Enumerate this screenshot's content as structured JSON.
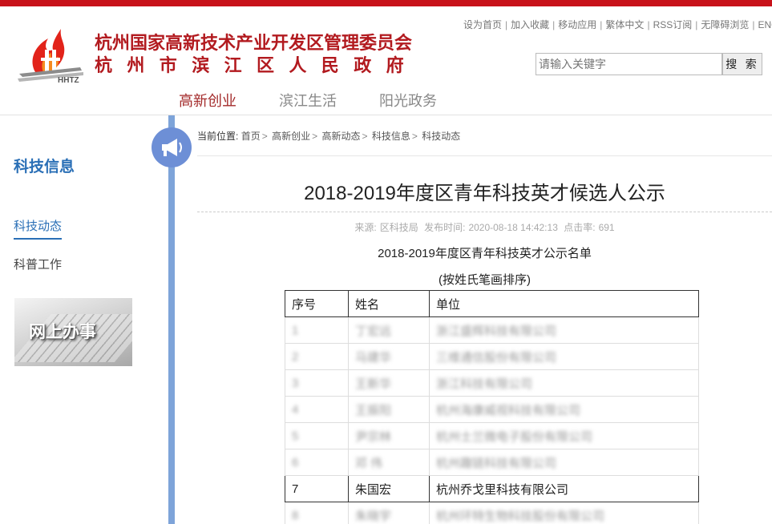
{
  "header": {
    "title_line1": "杭州国家高新技术产业开发区管理委员会",
    "title_line2": "杭州市滨江区人民政府",
    "logo_text": "HHTZ",
    "brand_color": "#c8121a"
  },
  "utility_links": [
    "设为首页",
    "加入收藏",
    "移动应用",
    "繁体中文",
    "RSS订阅",
    "无障碍浏览",
    "ENG"
  ],
  "search": {
    "placeholder": "请输入关键字",
    "button": "搜 索"
  },
  "main_nav": [
    {
      "label": "高新创业",
      "active": true
    },
    {
      "label": "滨江生活",
      "active": false
    },
    {
      "label": "阳光政务",
      "active": false
    }
  ],
  "sidebar": {
    "title": "科技信息",
    "items": [
      {
        "label": "科技动态",
        "active": true
      },
      {
        "label": "科普工作",
        "active": false
      }
    ],
    "banner_text": "网上办事"
  },
  "breadcrumb": {
    "label": "当前位置:",
    "items": [
      "首页",
      "高新创业",
      "高新动态",
      "科技信息",
      "科技动态"
    ]
  },
  "article": {
    "title": "2018-2019年度区青年科技英才候选人公示",
    "source_label": "来源:",
    "source": "区科技局",
    "time_label": "发布时间:",
    "time": "2020-08-18 14:42:13",
    "hits_label": "点击率:",
    "hits": "691",
    "subtitle": "2018-2019年度区青年科技英才公示名单",
    "subtitle2": "(按姓氏笔画排序)"
  },
  "table": {
    "headers": [
      "序号",
      "姓名",
      "单位"
    ],
    "rows": [
      {
        "no": "1",
        "name": "丁宏远",
        "unit": "浙江盛辉科技有限公司",
        "blurred": true
      },
      {
        "no": "2",
        "name": "马建华",
        "unit": "三维通信股份有限公司",
        "blurred": true
      },
      {
        "no": "3",
        "name": "王新华",
        "unit": "浙江科技有限公司",
        "blurred": true
      },
      {
        "no": "4",
        "name": "王振阳",
        "unit": "杭州海康威视科技有限公司",
        "blurred": true
      },
      {
        "no": "5",
        "name": "尹宗林",
        "unit": "杭州士兰微电子股份有限公司",
        "blurred": true
      },
      {
        "no": "6",
        "name": "邓 伟",
        "unit": "杭州趣链科技有限公司",
        "blurred": true
      },
      {
        "no": "7",
        "name": "朱国宏",
        "unit": "杭州乔戈里科技有限公司",
        "blurred": false
      },
      {
        "no": "8",
        "name": "朱晓宇",
        "unit": "杭州环特生物科技股份有限公司",
        "blurred": true
      }
    ]
  }
}
